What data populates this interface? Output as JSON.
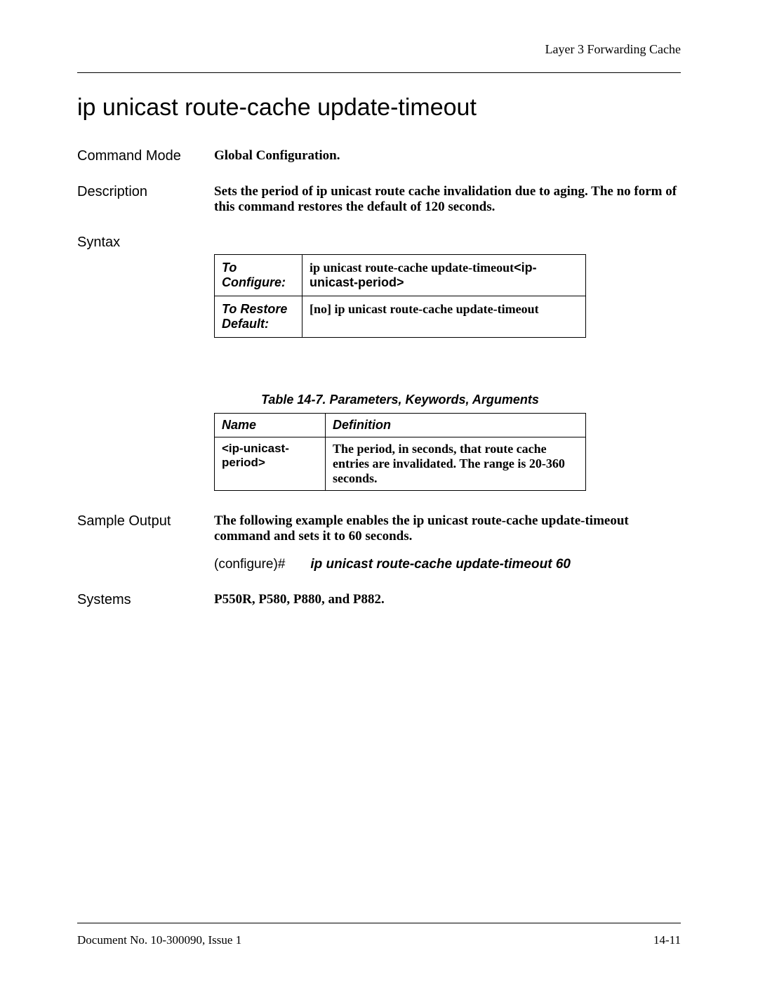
{
  "header": "Layer 3 Forwarding Cache",
  "title": "ip unicast route-cache update-timeout",
  "command_mode": {
    "label": "Command Mode",
    "value": "Global Configuration."
  },
  "description": {
    "label": "Description",
    "value": "Sets the period of ip unicast route cache invalidation due to aging. The no form of this command restores the default of 120 seconds."
  },
  "syntax": {
    "label": "Syntax",
    "rows": [
      {
        "label": "To Configure:",
        "cmd_bold": "ip unicast route-cache update-timeout",
        "cmd_sans": "<ip-unicast-period>"
      },
      {
        "label": "To Restore Default:",
        "cmd_bold": "[no] ip unicast route-cache update-timeout",
        "cmd_sans": ""
      }
    ]
  },
  "param_table": {
    "caption": "Table 14-7.  Parameters, Keywords, Arguments",
    "headers": {
      "name": "Name",
      "definition": "Definition"
    },
    "rows": [
      {
        "name": "<ip-unicast-period>",
        "definition": "The period, in seconds, that route cache entries are invalidated. The range is 20-360 seconds."
      }
    ]
  },
  "sample_output": {
    "label": "Sample Output",
    "text": "The following example enables the ip unicast route-cache update-timeout command and sets it to 60 seconds.",
    "prompt": "(configure)#",
    "command": "ip unicast route-cache update-timeout 60"
  },
  "systems": {
    "label": "Systems",
    "value": "P550R, P580, P880, and P882."
  },
  "footer": {
    "left": "Document No. 10-300090, Issue 1",
    "right": "14-11"
  }
}
